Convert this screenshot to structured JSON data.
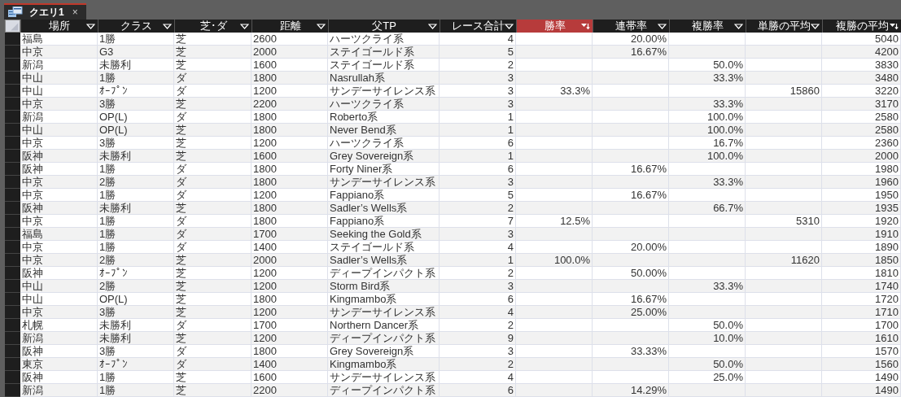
{
  "tab": {
    "label": "クエリ1",
    "close": "×",
    "selected": true
  },
  "table": {
    "columns": [
      {
        "label": "場所",
        "kind": "text",
        "selected": false,
        "sorted": false
      },
      {
        "label": "クラス",
        "kind": "text",
        "selected": false,
        "sorted": false
      },
      {
        "label": "芝･ダ",
        "kind": "text",
        "selected": false,
        "sorted": false
      },
      {
        "label": "距離",
        "kind": "text",
        "selected": false,
        "sorted": false
      },
      {
        "label": "父TP",
        "kind": "text",
        "selected": false,
        "sorted": false
      },
      {
        "label": "レース合計",
        "kind": "number",
        "selected": false,
        "sorted": false
      },
      {
        "label": "勝率",
        "kind": "number",
        "selected": true,
        "sorted": true
      },
      {
        "label": "連帯率",
        "kind": "number",
        "selected": false,
        "sorted": false
      },
      {
        "label": "複勝率",
        "kind": "number",
        "selected": false,
        "sorted": false
      },
      {
        "label": "単勝の平均",
        "kind": "number",
        "selected": false,
        "sorted": false
      },
      {
        "label": "複勝の平均",
        "kind": "number",
        "selected": false,
        "sorted": true
      }
    ],
    "rows": [
      {
        "cells": [
          "福島",
          "1勝",
          "芝",
          "2600",
          "ハーツクライ系",
          "4",
          null,
          "20.00%",
          null,
          null,
          "5040"
        ]
      },
      {
        "cells": [
          "中京",
          "G3",
          "芝",
          "2000",
          "ステイゴールド系",
          "5",
          null,
          "16.67%",
          null,
          null,
          "4200"
        ]
      },
      {
        "cells": [
          "新潟",
          "未勝利",
          "芝",
          "1600",
          "ステイゴールド系",
          "2",
          null,
          null,
          "50.0%",
          null,
          "3830"
        ]
      },
      {
        "cells": [
          "中山",
          "1勝",
          "ダ",
          "1800",
          "Nasrullah系",
          "3",
          null,
          null,
          "33.3%",
          null,
          "3480"
        ]
      },
      {
        "cells": [
          "中山",
          "ｵｰﾌﾟﾝ",
          "ダ",
          "1200",
          "サンデーサイレンス系",
          "3",
          "33.3%",
          null,
          null,
          "15860",
          "3220"
        ]
      },
      {
        "cells": [
          "中京",
          "3勝",
          "芝",
          "2200",
          "ハーツクライ系",
          "3",
          null,
          null,
          "33.3%",
          null,
          "3170"
        ]
      },
      {
        "cells": [
          "新潟",
          "OP(L)",
          "ダ",
          "1800",
          "Roberto系",
          "1",
          null,
          null,
          "100.0%",
          null,
          "2580"
        ]
      },
      {
        "cells": [
          "中山",
          "OP(L)",
          "芝",
          "1800",
          "Never Bend系",
          "1",
          null,
          null,
          "100.0%",
          null,
          "2580"
        ]
      },
      {
        "cells": [
          "中京",
          "3勝",
          "芝",
          "1200",
          "ハーツクライ系",
          "6",
          null,
          null,
          "16.7%",
          null,
          "2360"
        ]
      },
      {
        "cells": [
          "阪神",
          "未勝利",
          "芝",
          "1600",
          "Grey Sovereign系",
          "1",
          null,
          null,
          "100.0%",
          null,
          "2000"
        ]
      },
      {
        "cells": [
          "阪神",
          "1勝",
          "ダ",
          "1800",
          "Forty Niner系",
          "6",
          null,
          "16.67%",
          null,
          null,
          "1980"
        ]
      },
      {
        "cells": [
          "中京",
          "2勝",
          "ダ",
          "1800",
          "サンデーサイレンス系",
          "3",
          null,
          null,
          "33.3%",
          null,
          "1960"
        ]
      },
      {
        "cells": [
          "中京",
          "1勝",
          "ダ",
          "1200",
          "Fappiano系",
          "5",
          null,
          "16.67%",
          null,
          null,
          "1950"
        ]
      },
      {
        "cells": [
          "阪神",
          "未勝利",
          "芝",
          "1800",
          "Sadler’s Wells系",
          "2",
          null,
          null,
          "66.7%",
          null,
          "1935"
        ]
      },
      {
        "cells": [
          "中京",
          "1勝",
          "ダ",
          "1800",
          "Fappiano系",
          "7",
          "12.5%",
          null,
          null,
          "5310",
          "1920"
        ]
      },
      {
        "cells": [
          "福島",
          "1勝",
          "ダ",
          "1700",
          "Seeking the Gold系",
          "3",
          null,
          null,
          null,
          null,
          "1910"
        ]
      },
      {
        "cells": [
          "中京",
          "1勝",
          "ダ",
          "1400",
          "ステイゴールド系",
          "4",
          null,
          "20.00%",
          null,
          null,
          "1890"
        ]
      },
      {
        "cells": [
          "中京",
          "2勝",
          "芝",
          "2000",
          "Sadler’s Wells系",
          "1",
          "100.0%",
          null,
          null,
          "11620",
          "1850"
        ]
      },
      {
        "cells": [
          "阪神",
          "ｵｰﾌﾟﾝ",
          "芝",
          "1200",
          "ディープインパクト系",
          "2",
          null,
          "50.00%",
          null,
          null,
          "1810"
        ]
      },
      {
        "cells": [
          "中山",
          "2勝",
          "芝",
          "1200",
          "Storm Bird系",
          "3",
          null,
          null,
          "33.3%",
          null,
          "1740"
        ]
      },
      {
        "cells": [
          "中山",
          "OP(L)",
          "芝",
          "1800",
          "Kingmambo系",
          "6",
          null,
          "16.67%",
          null,
          null,
          "1720"
        ]
      },
      {
        "cells": [
          "中京",
          "3勝",
          "芝",
          "1200",
          "サンデーサイレンス系",
          "4",
          null,
          "25.00%",
          null,
          null,
          "1710"
        ]
      },
      {
        "cells": [
          "札幌",
          "未勝利",
          "ダ",
          "1700",
          "Northern Dancer系",
          "2",
          null,
          null,
          "50.0%",
          null,
          "1700"
        ]
      },
      {
        "cells": [
          "新潟",
          "未勝利",
          "芝",
          "1200",
          "ディープインパクト系",
          "9",
          null,
          null,
          "10.0%",
          null,
          "1610"
        ]
      },
      {
        "cells": [
          "阪神",
          "3勝",
          "ダ",
          "1800",
          "Grey Sovereign系",
          "3",
          null,
          "33.33%",
          null,
          null,
          "1570"
        ]
      },
      {
        "cells": [
          "東京",
          "ｵｰﾌﾟﾝ",
          "ダ",
          "1400",
          "Kingmambo系",
          "2",
          null,
          null,
          "50.0%",
          null,
          "1560"
        ]
      },
      {
        "cells": [
          "阪神",
          "1勝",
          "芝",
          "1600",
          "サンデーサイレンス系",
          "4",
          null,
          null,
          "25.0%",
          null,
          "1490"
        ]
      },
      {
        "cells": [
          "新潟",
          "1勝",
          "芝",
          "2200",
          "ディープインパクト系",
          "6",
          null,
          "14.29%",
          null,
          null,
          "1490"
        ]
      }
    ]
  }
}
